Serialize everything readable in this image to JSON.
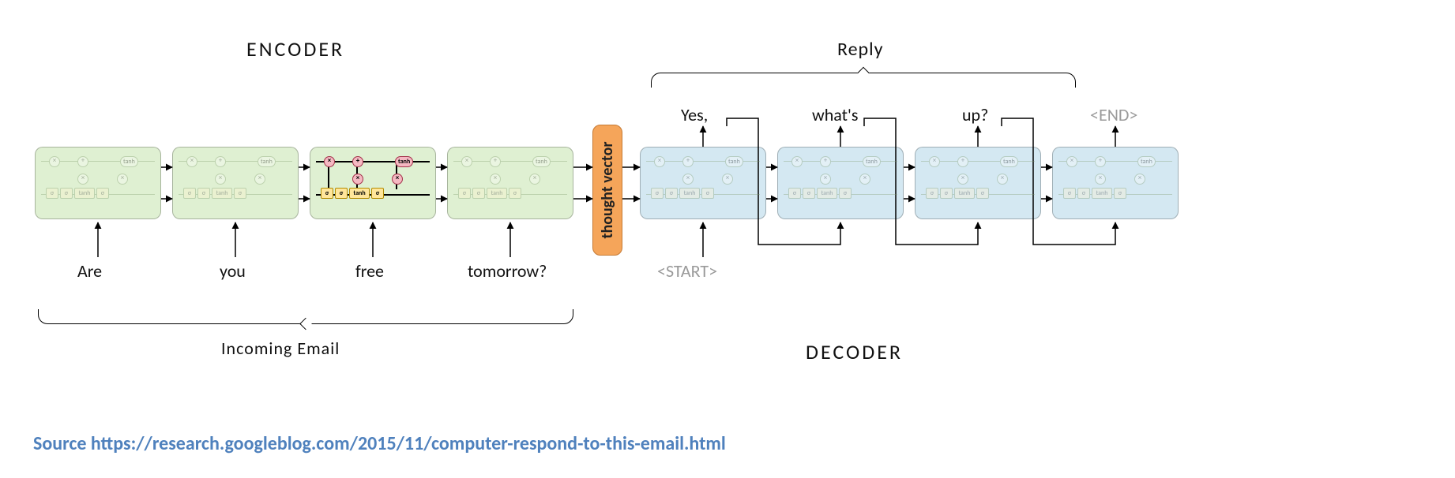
{
  "titles": {
    "encoder": "ENCODER",
    "decoder": "DECODER",
    "reply": "Reply",
    "incoming": "Incoming Email"
  },
  "encoder_inputs": [
    "Are",
    "you",
    "free",
    "tomorrow?"
  ],
  "decoder_outputs": [
    "Yes,",
    "what's",
    "up?",
    "<END>"
  ],
  "decoder_inputs": [
    "<START>"
  ],
  "thought_vector_label": "thought vector",
  "source": "Source https://research.googleblog.com/2015/11/computer-respond-to-this-email.html",
  "cell_glyphs": {
    "sigma": "σ",
    "tanh": "tanh",
    "mul": "×",
    "add": "+"
  }
}
